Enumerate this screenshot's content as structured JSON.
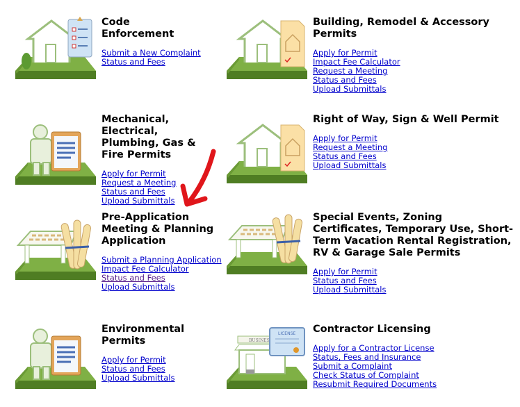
{
  "colors": {
    "link": "#0000cc",
    "visited": "#551a8b",
    "platform": "#5a8a2a",
    "arrow": "#e0161b"
  },
  "sections": [
    {
      "id": "code-enforcement",
      "icon": "house-checklist-icon",
      "title": "Code Enforcement",
      "links": [
        "Submit a New Complaint",
        "Status and Fees"
      ]
    },
    {
      "id": "building-permits",
      "icon": "house-blueprint-icon",
      "title": "Building, Remodel & Accessory Permits",
      "links": [
        "Apply for Permit",
        "Impact Fee Calculator",
        "Request a Meeting",
        "Status and Fees",
        "Upload Submittals"
      ]
    },
    {
      "id": "mechanical-permits",
      "icon": "worker-clipboard-icon",
      "title": "Mechanical, Electrical, Plumbing, Gas & Fire Permits",
      "links": [
        "Apply for Permit",
        "Request a Meeting",
        "Status and Fees",
        "Upload Submittals"
      ]
    },
    {
      "id": "right-of-way",
      "icon": "house-blueprint-icon",
      "title": "Right of Way, Sign & Well Permit",
      "links": [
        "Apply for Permit",
        "Request a Meeting",
        "Status and Fees",
        "Upload Submittals"
      ]
    },
    {
      "id": "pre-application",
      "icon": "planning-table-scrolls-icon",
      "title": "Pre-Application Meeting & Planning Application",
      "links": [
        "Submit a Planning Application",
        "Impact Fee Calculator",
        "Status and Fees",
        "Upload Submittals"
      ]
    },
    {
      "id": "special-events",
      "icon": "planning-table-scrolls-icon",
      "title": "Special Events, Zoning Certificates, Temporary Use, Short-Term Vacation Rental Registration, RV & Garage Sale Permits",
      "links": [
        "Apply for Permit",
        "Status and Fees",
        "Upload Submittals"
      ]
    },
    {
      "id": "environmental",
      "icon": "worker-clipboard-icon",
      "title": "Environmental Permits",
      "links": [
        "Apply for Permit",
        "Status and Fees",
        "Upload Submittals"
      ]
    },
    {
      "id": "contractor-licensing",
      "icon": "business-license-icon",
      "title": "Contractor Licensing",
      "illus_label": "BUSINESS",
      "license_label": "LICENSE",
      "links": [
        "Apply for a Contractor License",
        "Status, Fees and Insurance",
        "Submit a Complaint",
        "Check Status of Complaint",
        "Resubmit Required Documents"
      ]
    }
  ]
}
